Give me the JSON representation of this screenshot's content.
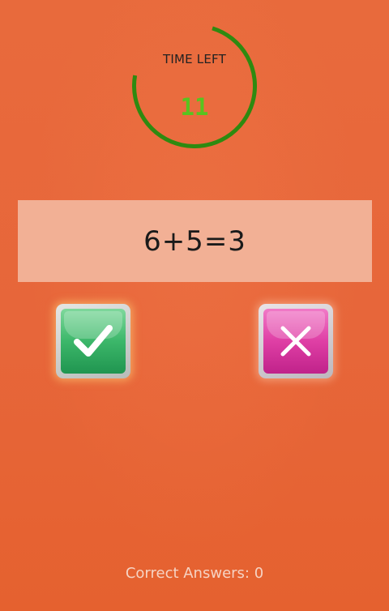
{
  "timer": {
    "label": "TIME LEFT",
    "value": "11",
    "remaining_fraction": 0.73,
    "ring_color": "#2e8a10",
    "value_color": "#58c41f"
  },
  "equation": {
    "text": "6+5=3"
  },
  "buttons": {
    "correct_icon": "check-icon",
    "wrong_icon": "cross-icon",
    "correct_color": "#3cb76a",
    "wrong_color": "#df3fa5"
  },
  "score": {
    "label": "Correct Answers: 0"
  },
  "colors": {
    "background": "#e8673a",
    "panel": "#f2b095"
  }
}
